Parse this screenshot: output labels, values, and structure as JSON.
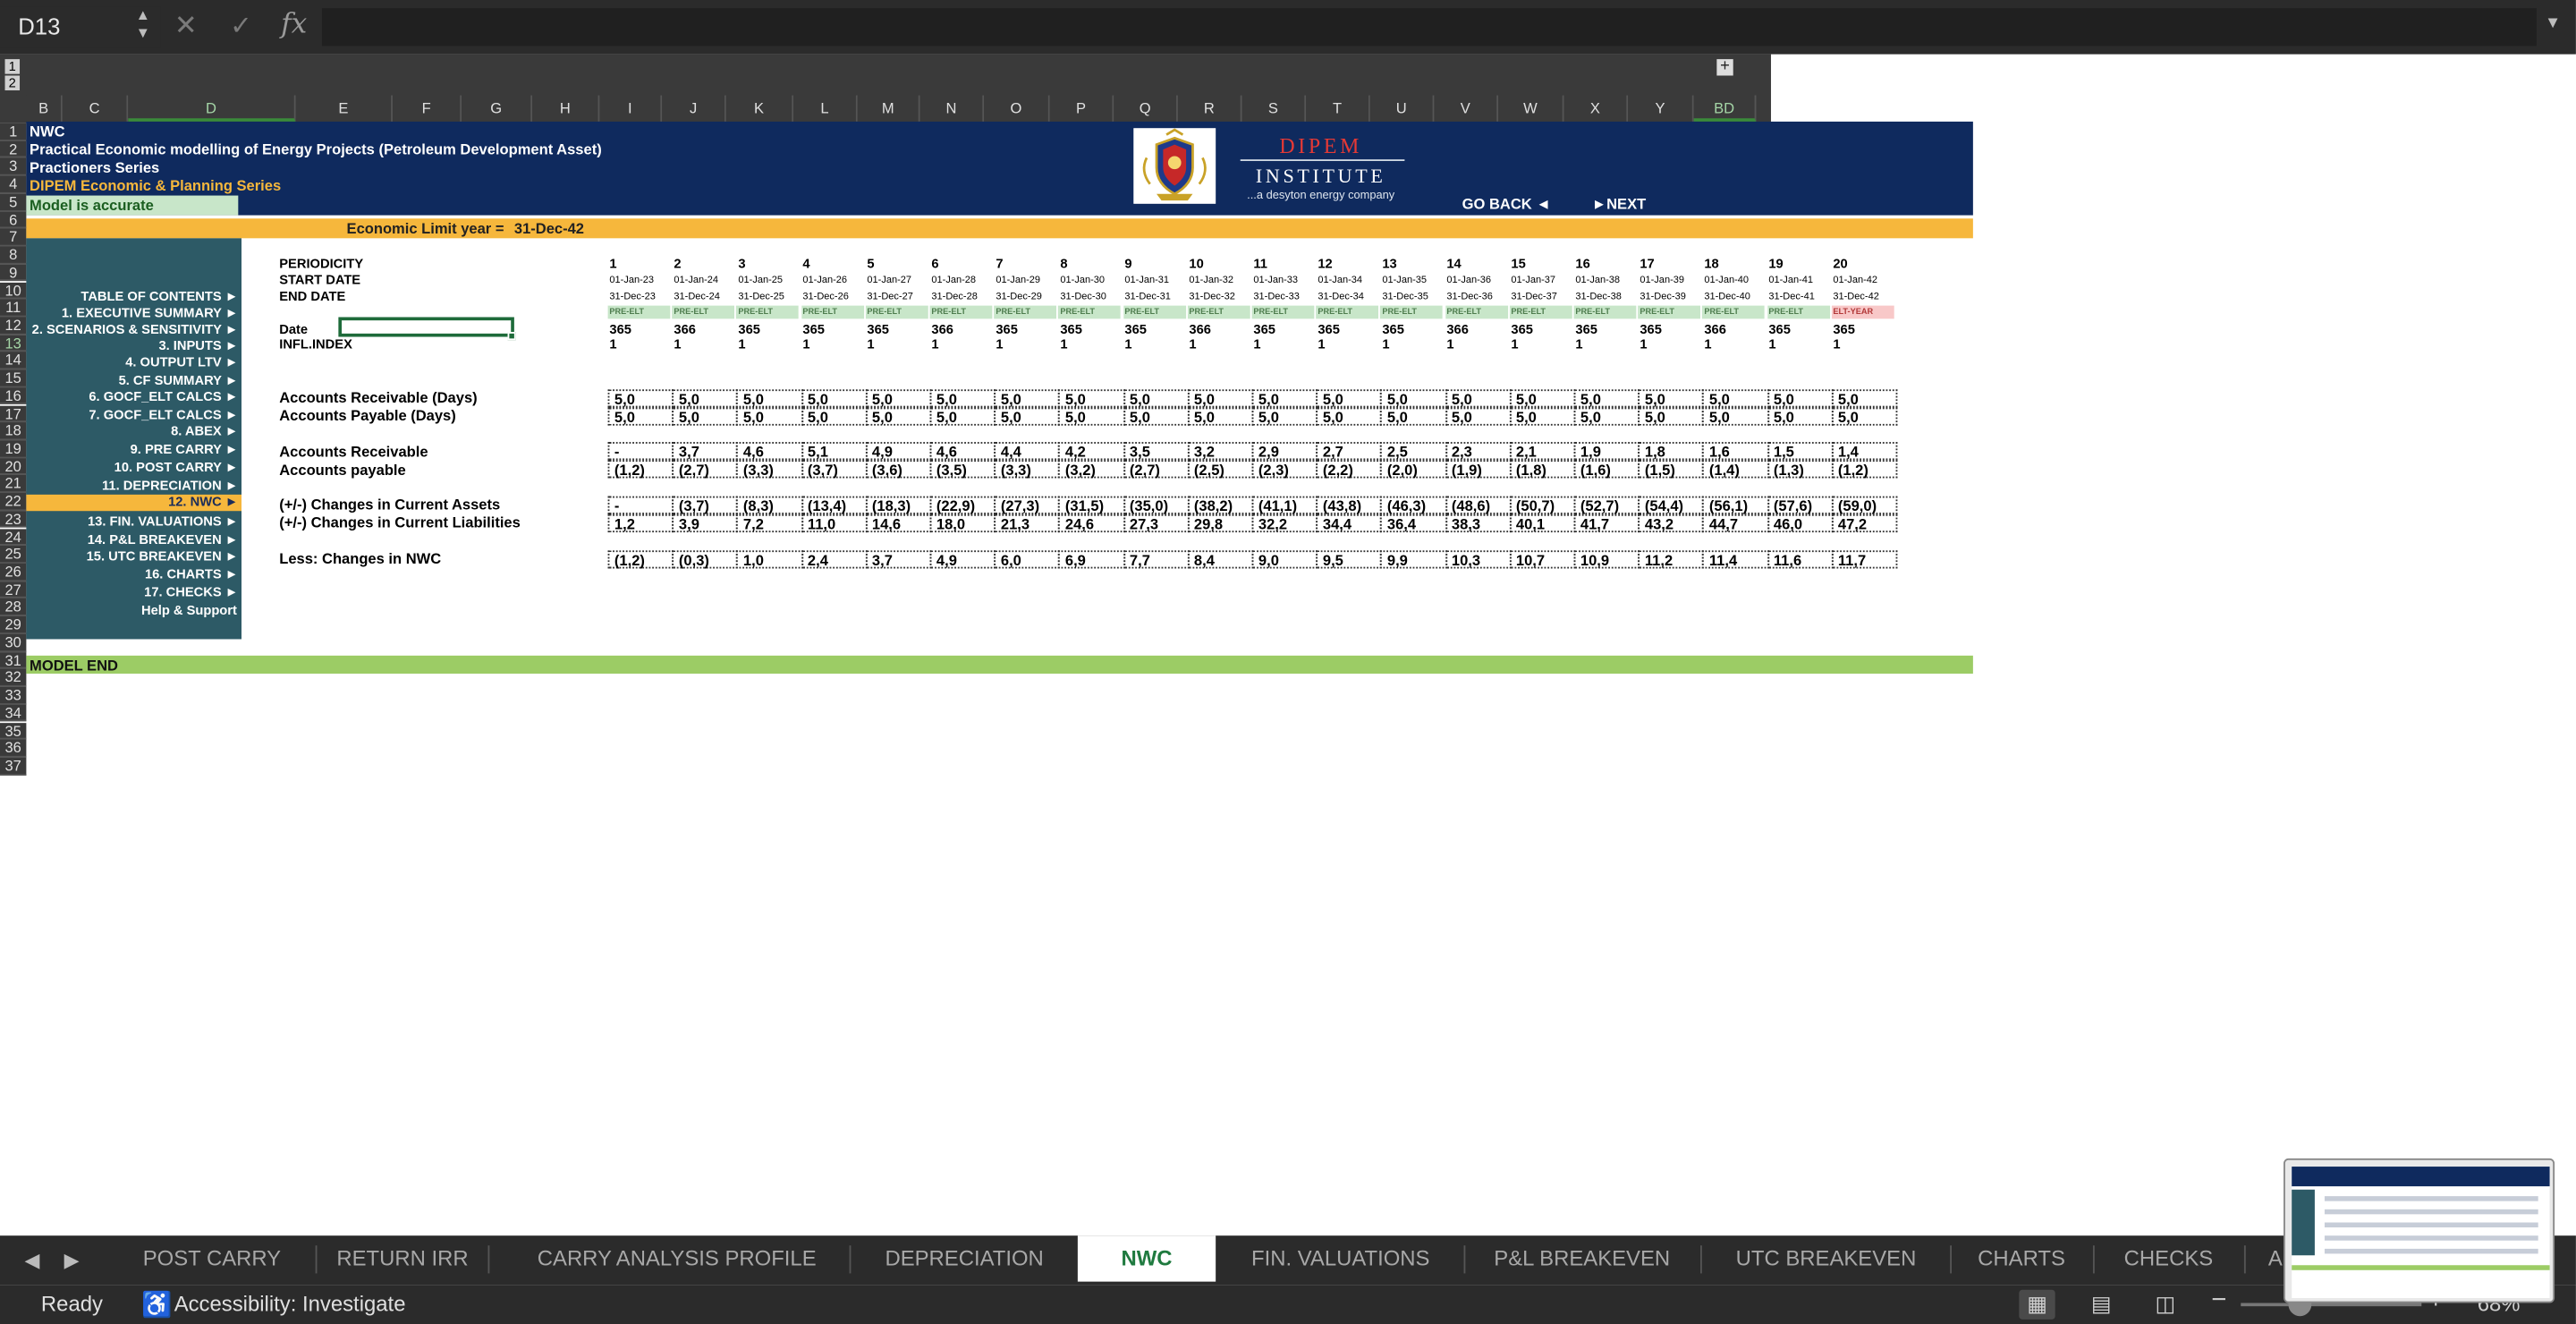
{
  "formula_bar": {
    "name_box": "D13",
    "formula": ""
  },
  "colors": {
    "header_band": "#0f2a5e",
    "orange_band": "#f6b73c",
    "sidebar": "#2d5a66",
    "end_band": "#9ccc65",
    "accent_green": "#1f7a3f"
  },
  "column_letters": [
    "B",
    "C",
    "D",
    "E",
    "F",
    "G",
    "H",
    "I",
    "J",
    "K",
    "L",
    "M",
    "N",
    "O",
    "P",
    "Q",
    "R",
    "S",
    "T",
    "U",
    "V",
    "W",
    "X",
    "Y",
    "BD"
  ],
  "row_numbers": [
    "1",
    "2",
    "3",
    "4",
    "5",
    "6",
    "7",
    "8",
    "9",
    "10",
    "11",
    "12",
    "13",
    "14",
    "15",
    "16",
    "17",
    "18",
    "19",
    "20",
    "21",
    "22",
    "23",
    "24",
    "25",
    "26",
    "27",
    "28",
    "29",
    "30",
    "31",
    "32",
    "33",
    "34",
    "35",
    "36",
    "37"
  ],
  "outline_levels": [
    "1",
    "2"
  ],
  "header": {
    "line1": "NWC",
    "line2": "Practical Economic modelling of Energy Projects (Petroleum Development Asset)",
    "line3": "Practioners Series",
    "line4": "DIPEM Economic & Planning Series",
    "status": "Model is accurate",
    "institute_name": "DIPEM",
    "institute_sub": "INSTITUTE",
    "institute_tagline": "...a desyton energy company",
    "go_back": "GO BACK ◄",
    "next": "►NEXT"
  },
  "economic_limit": {
    "label": "Economic Limit year =",
    "value": "31-Dec-42"
  },
  "toc": [
    "TABLE OF CONTENTS  ►",
    "1.  EXECUTIVE SUMMARY  ►",
    "2.  SCENARIOS & SENSITIVITY  ►",
    "3.  INPUTS  ►",
    "4.  OUTPUT LTV  ►",
    "5.  CF SUMMARY  ►",
    "6.  GOCF_ELT CALCS  ►",
    "7.  GOCF_ELT CALCS  ►",
    "8.  ABEX  ►",
    "9.  PRE CARRY  ►",
    "10.  POST CARRY  ►",
    "11.  DEPRECIATION  ►",
    "12.  NWC  ►",
    "13.  FIN. VALUATIONS  ►",
    "14.  P&L BREAKEVEN  ►",
    "15.  UTC BREAKEVEN  ►",
    "16.  CHARTS  ►",
    "17.  CHECKS  ►"
  ],
  "help": "Help & Support",
  "labels": {
    "periodicity": "PERIODICITY",
    "start_date": "START DATE",
    "end_date": "END DATE",
    "date": "Date",
    "infl": "INFL.INDEX",
    "ar_days": "Accounts Receivable (Days)",
    "ap_days": "Accounts Payable (Days)",
    "ar": "Accounts Receivable",
    "ap": "Accounts payable",
    "chg_ca": "(+/-) Changes in Current Assets",
    "chg_cl": "(+/-) Changes in Current Liabilities",
    "less_nwc": "Less: Changes in NWC"
  },
  "periods": [
    "1",
    "2",
    "3",
    "4",
    "5",
    "6",
    "7",
    "8",
    "9",
    "10",
    "11",
    "12",
    "13",
    "14",
    "15",
    "16",
    "17",
    "18",
    "19",
    "20"
  ],
  "start_dates": [
    "01-Jan-23",
    "01-Jan-24",
    "01-Jan-25",
    "01-Jan-26",
    "01-Jan-27",
    "01-Jan-28",
    "01-Jan-29",
    "01-Jan-30",
    "01-Jan-31",
    "01-Jan-32",
    "01-Jan-33",
    "01-Jan-34",
    "01-Jan-35",
    "01-Jan-36",
    "01-Jan-37",
    "01-Jan-38",
    "01-Jan-39",
    "01-Jan-40",
    "01-Jan-41",
    "01-Jan-42"
  ],
  "end_dates": [
    "31-Dec-23",
    "31-Dec-24",
    "31-Dec-25",
    "31-Dec-26",
    "31-Dec-27",
    "31-Dec-28",
    "31-Dec-29",
    "31-Dec-30",
    "31-Dec-31",
    "31-Dec-32",
    "31-Dec-33",
    "31-Dec-34",
    "31-Dec-35",
    "31-Dec-36",
    "31-Dec-37",
    "31-Dec-38",
    "31-Dec-39",
    "31-Dec-40",
    "31-Dec-41",
    "31-Dec-42"
  ],
  "flags": [
    "PRE-ELT",
    "PRE-ELT",
    "PRE-ELT",
    "PRE-ELT",
    "PRE-ELT",
    "PRE-ELT",
    "PRE-ELT",
    "PRE-ELT",
    "PRE-ELT",
    "PRE-ELT",
    "PRE-ELT",
    "PRE-ELT",
    "PRE-ELT",
    "PRE-ELT",
    "PRE-ELT",
    "PRE-ELT",
    "PRE-ELT",
    "PRE-ELT",
    "PRE-ELT",
    "ELT-YEAR"
  ],
  "days": [
    "365",
    "366",
    "365",
    "365",
    "365",
    "366",
    "365",
    "365",
    "365",
    "366",
    "365",
    "365",
    "365",
    "366",
    "365",
    "365",
    "365",
    "366",
    "365",
    "365"
  ],
  "infl_index": [
    "1",
    "1",
    "1",
    "1",
    "1",
    "1",
    "1",
    "1",
    "1",
    "1",
    "1",
    "1",
    "1",
    "1",
    "1",
    "1",
    "1",
    "1",
    "1",
    "1"
  ],
  "ar_days": [
    "5,0",
    "5,0",
    "5,0",
    "5,0",
    "5,0",
    "5,0",
    "5,0",
    "5,0",
    "5,0",
    "5,0",
    "5,0",
    "5,0",
    "5,0",
    "5,0",
    "5,0",
    "5,0",
    "5,0",
    "5,0",
    "5,0",
    "5,0"
  ],
  "ap_days": [
    "5,0",
    "5,0",
    "5,0",
    "5,0",
    "5,0",
    "5,0",
    "5,0",
    "5,0",
    "5,0",
    "5,0",
    "5,0",
    "5,0",
    "5,0",
    "5,0",
    "5,0",
    "5,0",
    "5,0",
    "5,0",
    "5,0",
    "5,0"
  ],
  "ar": [
    "-",
    "3,7",
    "4,6",
    "5,1",
    "4,9",
    "4,6",
    "4,4",
    "4,2",
    "3,5",
    "3,2",
    "2,9",
    "2,7",
    "2,5",
    "2,3",
    "2,1",
    "1,9",
    "1,8",
    "1,6",
    "1,5",
    "1,4"
  ],
  "ap": [
    "(1,2)",
    "(2,7)",
    "(3,3)",
    "(3,7)",
    "(3,6)",
    "(3,5)",
    "(3,3)",
    "(3,2)",
    "(2,7)",
    "(2,5)",
    "(2,3)",
    "(2,2)",
    "(2,0)",
    "(1,9)",
    "(1,8)",
    "(1,6)",
    "(1,5)",
    "(1,4)",
    "(1,3)",
    "(1,2)"
  ],
  "chg_ca": [
    "-",
    "(3,7)",
    "(8,3)",
    "(13,4)",
    "(18,3)",
    "(22,9)",
    "(27,3)",
    "(31,5)",
    "(35,0)",
    "(38,2)",
    "(41,1)",
    "(43,8)",
    "(46,3)",
    "(48,6)",
    "(50,7)",
    "(52,7)",
    "(54,4)",
    "(56,1)",
    "(57,6)",
    "(59,0)"
  ],
  "chg_cl": [
    "1,2",
    "3,9",
    "7,2",
    "11,0",
    "14,6",
    "18,0",
    "21,3",
    "24,6",
    "27,3",
    "29,8",
    "32,2",
    "34,4",
    "36,4",
    "38,3",
    "40,1",
    "41,7",
    "43,2",
    "44,7",
    "46,0",
    "47,2"
  ],
  "less_nwc": [
    "(1,2)",
    "(0,3)",
    "1,0",
    "2,4",
    "3,7",
    "4,9",
    "6,0",
    "6,9",
    "7,7",
    "8,4",
    "9,0",
    "9,5",
    "9,9",
    "10,3",
    "10,7",
    "10,9",
    "11,2",
    "11,4",
    "11,6",
    "11,7"
  ],
  "model_end": "MODEL END",
  "sheet_tabs": [
    "POST CARRY",
    "RETURN IRR",
    "CARRY ANALYSIS PROFILE",
    "DEPRECIATION",
    "NWC",
    "FIN. VALUATIONS",
    "P&L BREAKEVEN",
    "UTC BREAKEVEN",
    "CHARTS",
    "CHECKS",
    "A"
  ],
  "active_tab": "NWC",
  "status_bar": {
    "ready": "Ready",
    "accessibility": "Accessibility: Investigate",
    "zoom": "68%"
  }
}
